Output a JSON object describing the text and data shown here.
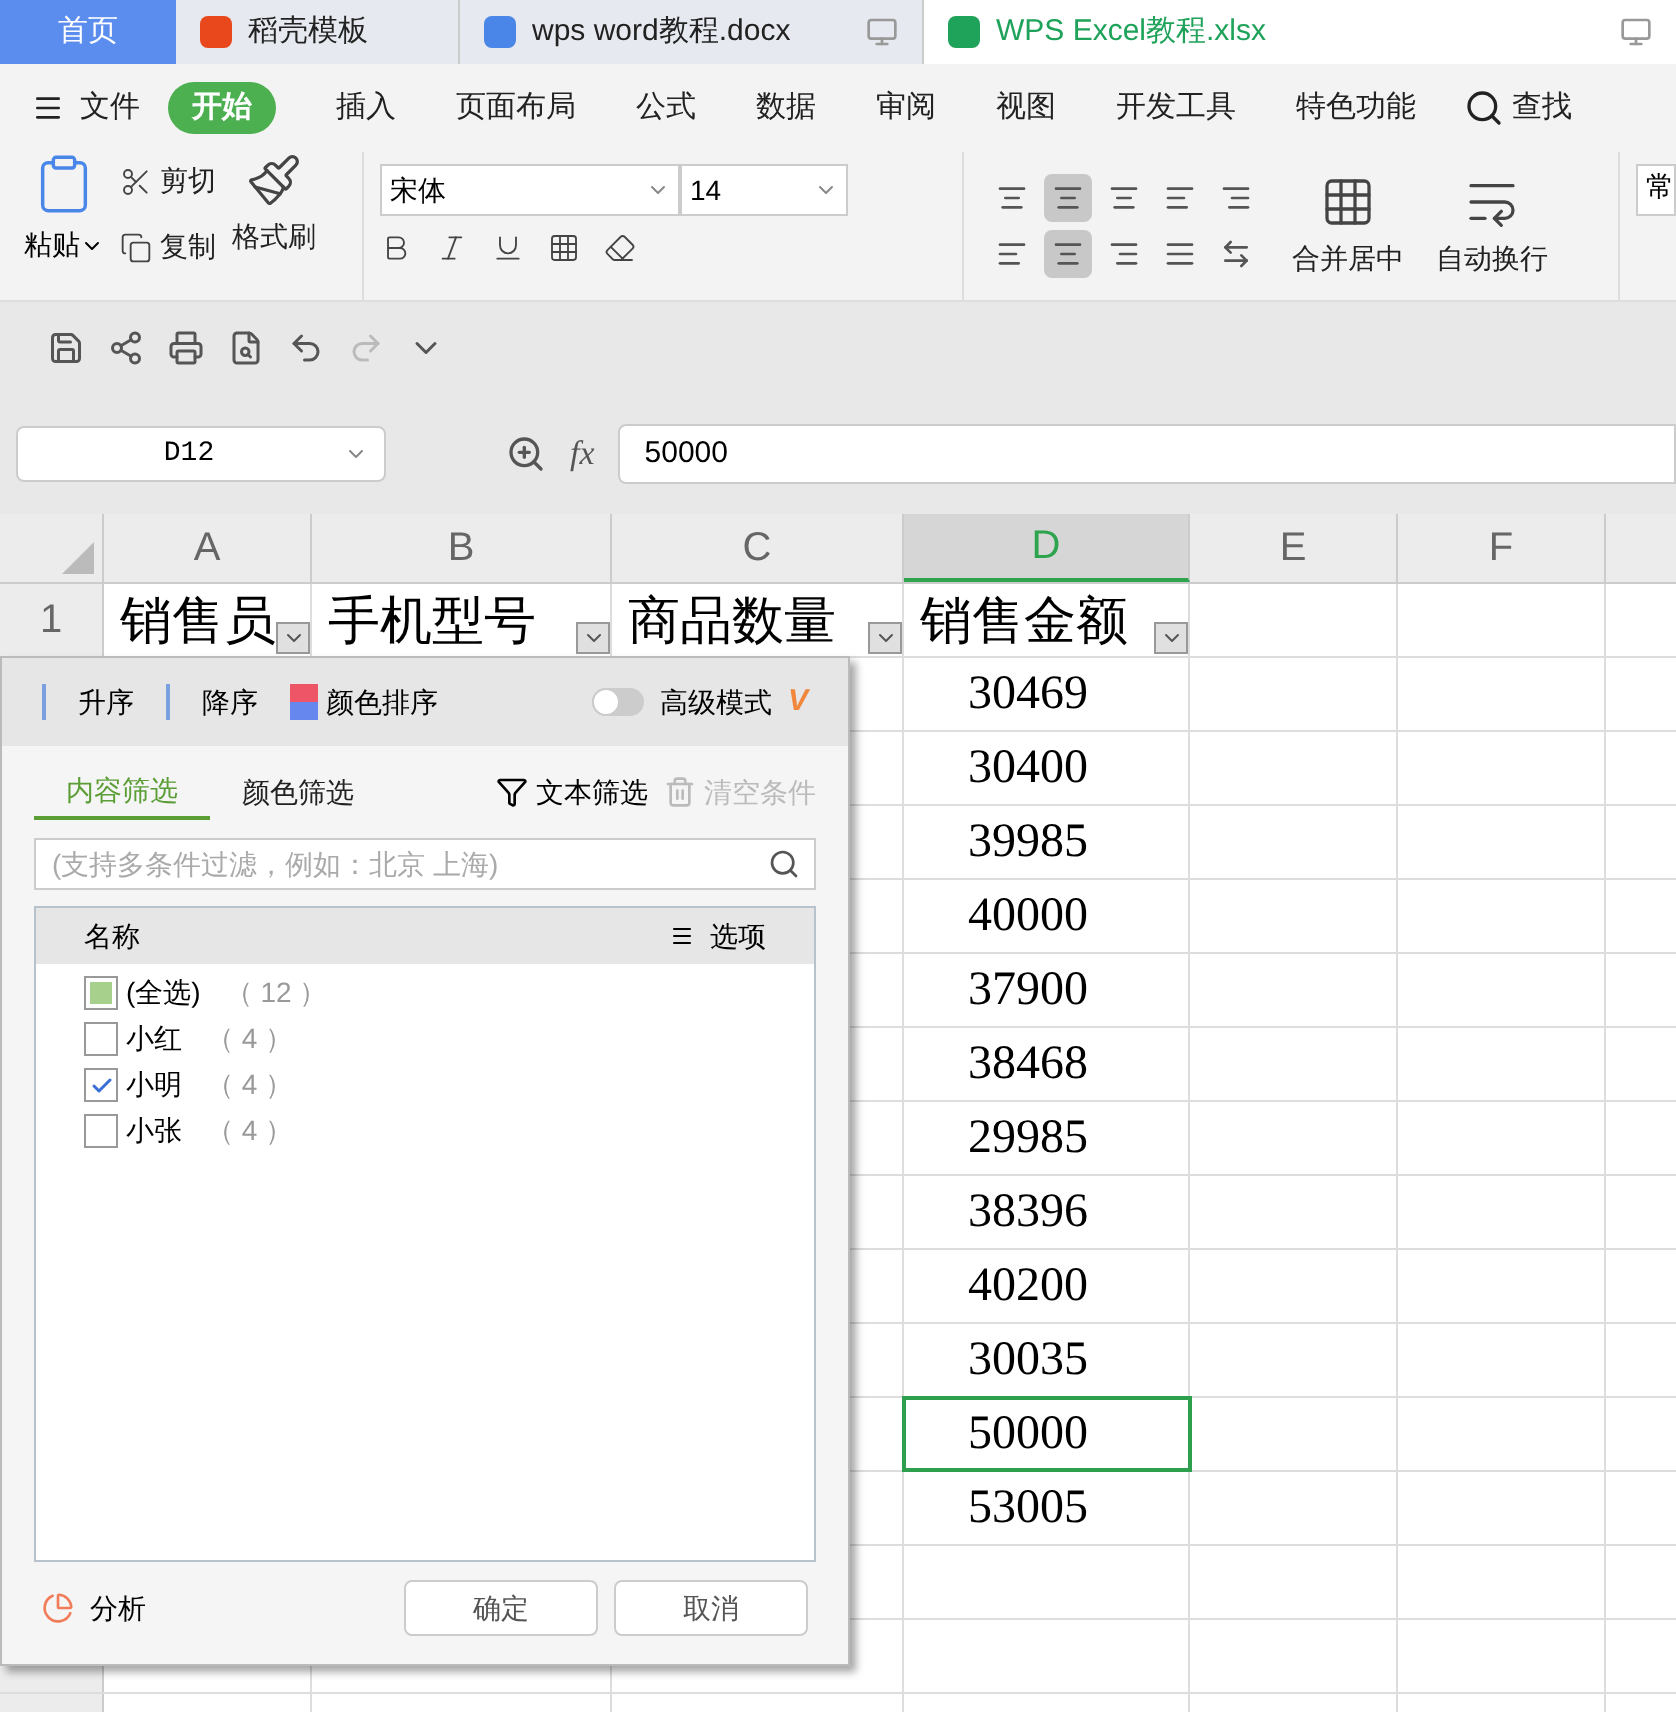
{
  "tabs": [
    {
      "label": "首页",
      "kind": "home",
      "selected": false
    },
    {
      "label": "稻壳模板",
      "kind": "docer",
      "selected": false
    },
    {
      "label": "wps word教程.docx",
      "kind": "word",
      "selected": false
    },
    {
      "label": "WPS Excel教程.xlsx",
      "kind": "excel",
      "selected": true
    }
  ],
  "menu": {
    "file": "文件",
    "items": [
      {
        "label": "开始",
        "selected": true
      },
      {
        "label": "插入",
        "selected": false
      },
      {
        "label": "页面布局",
        "selected": false
      },
      {
        "label": "公式",
        "selected": false
      },
      {
        "label": "数据",
        "selected": false
      },
      {
        "label": "审阅",
        "selected": false
      },
      {
        "label": "视图",
        "selected": false
      },
      {
        "label": "开发工具",
        "selected": false
      },
      {
        "label": "特色功能",
        "selected": false
      }
    ],
    "search": "查找"
  },
  "ribbon": {
    "paste": "粘贴",
    "cut": "剪切",
    "copy": "复制",
    "format_painter": "格式刷",
    "font": "宋体",
    "size": "14",
    "merge": "合并居中",
    "wrap": "自动换行",
    "cut_off": "常"
  },
  "formula_bar": {
    "name_box": "D12",
    "fx": "fx",
    "value": "50000"
  },
  "sheet": {
    "columns": [
      {
        "label": "A",
        "selected": false
      },
      {
        "label": "B",
        "selected": false
      },
      {
        "label": "C",
        "selected": false
      },
      {
        "label": "D",
        "selected": true
      },
      {
        "label": "E",
        "selected": false
      },
      {
        "label": "F",
        "selected": false
      }
    ],
    "row_label": "1",
    "headers": [
      "销售员",
      "手机型号",
      "商品数量",
      "销售金额"
    ],
    "amounts": [
      {
        "value": "30469",
        "selected": false
      },
      {
        "value": "30400",
        "selected": false
      },
      {
        "value": "39985",
        "selected": false
      },
      {
        "value": "40000",
        "selected": false
      },
      {
        "value": "37900",
        "selected": false
      },
      {
        "value": "38468",
        "selected": false
      },
      {
        "value": "29985",
        "selected": false
      },
      {
        "value": "38396",
        "selected": false
      },
      {
        "value": "40200",
        "selected": false
      },
      {
        "value": "30035",
        "selected": false
      },
      {
        "value": "50000",
        "selected": true
      },
      {
        "value": "53005",
        "selected": false
      }
    ]
  },
  "filter_popup": {
    "sort": [
      "升序",
      "降序",
      "颜色排序"
    ],
    "advanced": {
      "label": "高级模式",
      "on": false,
      "badge": "V"
    },
    "tabs": [
      {
        "label": "内容筛选",
        "selected": true
      },
      {
        "label": "颜色筛选",
        "selected": false
      }
    ],
    "text_filter": "文本筛选",
    "clear": {
      "label": "清空条件",
      "disabled": true
    },
    "search": {
      "placeholder": "(支持多条件过滤，例如：北京 上海)"
    },
    "list_header": "名称",
    "options": "选项",
    "items": [
      {
        "label": "(全选)",
        "count": "（ 12 ）",
        "checked": false,
        "partial": true
      },
      {
        "label": "小红",
        "count": "（ 4 ）",
        "checked": false,
        "partial": false
      },
      {
        "label": "小明",
        "count": "（ 4 ）",
        "checked": true,
        "partial": false
      },
      {
        "label": "小张",
        "count": "（ 4 ）",
        "checked": false,
        "partial": false
      }
    ],
    "analysis": "分析",
    "ok": "确定",
    "cancel": "取消"
  }
}
